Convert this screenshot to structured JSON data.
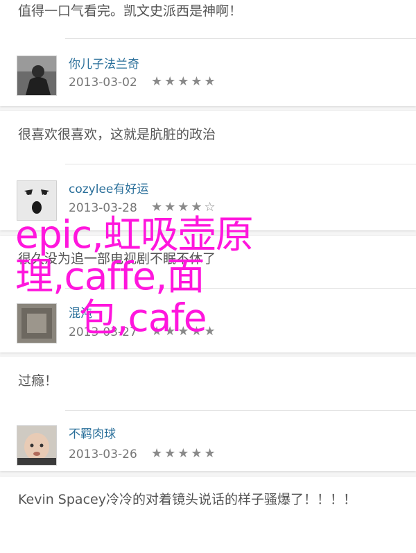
{
  "reviews": [
    {
      "comment": "值得一口气看完。凯文史派西是神啊！",
      "username": "你儿子法兰奇",
      "date": "2013-03-02",
      "stars": "★★★★★",
      "avatar_icon": "user-photo-avatar"
    },
    {
      "comment": "很喜欢很喜欢，这就是肮脏的政治",
      "username": "cozylee有好运",
      "date": "2013-03-28",
      "stars": "★★★★☆",
      "avatar_icon": "cartoon-face-avatar"
    },
    {
      "comment": "很久没为追一部电视剧不眠不休了",
      "username": "混沌",
      "date": "2013-03-27",
      "stars": "★★★★★",
      "avatar_icon": "dark-photo-avatar"
    },
    {
      "comment": "过瘾！",
      "username": "不羁肉球",
      "date": "2013-03-26",
      "stars": "★★★★★",
      "avatar_icon": "baby-photo-avatar"
    },
    {
      "comment": "Kevin Spacey冷冷的对着镜头说话的样子骚爆了！！！！"
    }
  ],
  "overlay": {
    "line1": "epic,虹吸壶原",
    "line2": "理,caffe,面",
    "line3": "包,cafe"
  },
  "colors": {
    "overlay_text": "#ff16dd",
    "username": "#2a6f9a",
    "star": "#8a8a8a"
  }
}
